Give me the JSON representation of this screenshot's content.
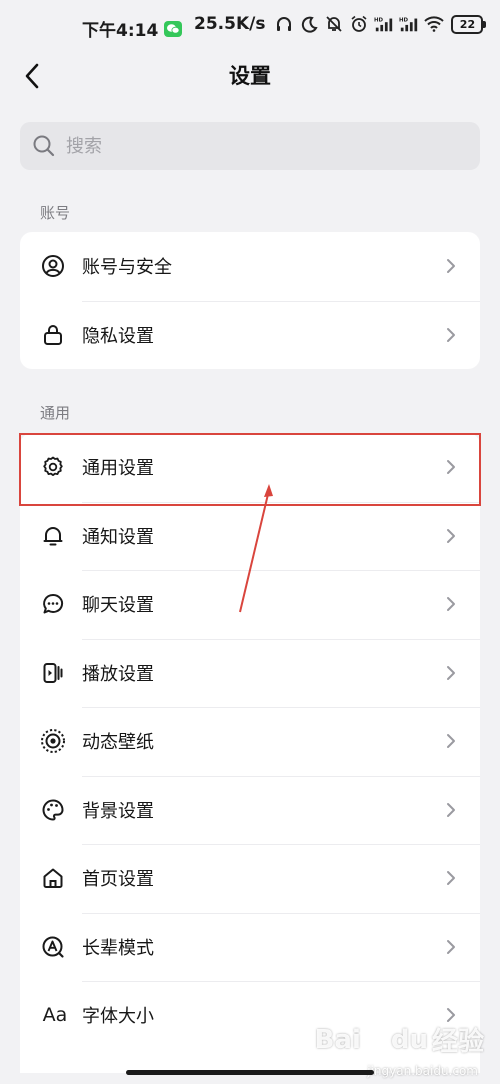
{
  "status_bar": {
    "time": "下午4:14",
    "net_speed": "25.5K/s",
    "battery": "22"
  },
  "header": {
    "title": "设置",
    "back_icon": "chevron-left-icon"
  },
  "search": {
    "placeholder": "搜索"
  },
  "sections": [
    {
      "title": "账号",
      "items": [
        {
          "label": "账号与安全",
          "icon": "user-circle-icon"
        },
        {
          "label": "隐私设置",
          "icon": "lock-icon"
        }
      ]
    },
    {
      "title": "通用",
      "items": [
        {
          "label": "通用设置",
          "icon": "gear-icon"
        },
        {
          "label": "通知设置",
          "icon": "bell-icon"
        },
        {
          "label": "聊天设置",
          "icon": "chat-bubble-icon"
        },
        {
          "label": "播放设置",
          "icon": "play-device-icon"
        },
        {
          "label": "动态壁纸",
          "icon": "dynamic-wallpaper-icon"
        },
        {
          "label": "背景设置",
          "icon": "palette-icon"
        },
        {
          "label": "首页设置",
          "icon": "home-icon"
        },
        {
          "label": "长辈模式",
          "icon": "elder-mode-icon"
        },
        {
          "label": "字体大小",
          "icon": "font-size-icon"
        }
      ]
    }
  ],
  "font_size_icon_text": "Aa",
  "annotation": {
    "highlight_color": "#d9453d"
  },
  "watermark": {
    "logo": "Bai",
    "logo_mark": "du",
    "text": "经验",
    "sub": "jingyan.baidu.com"
  }
}
